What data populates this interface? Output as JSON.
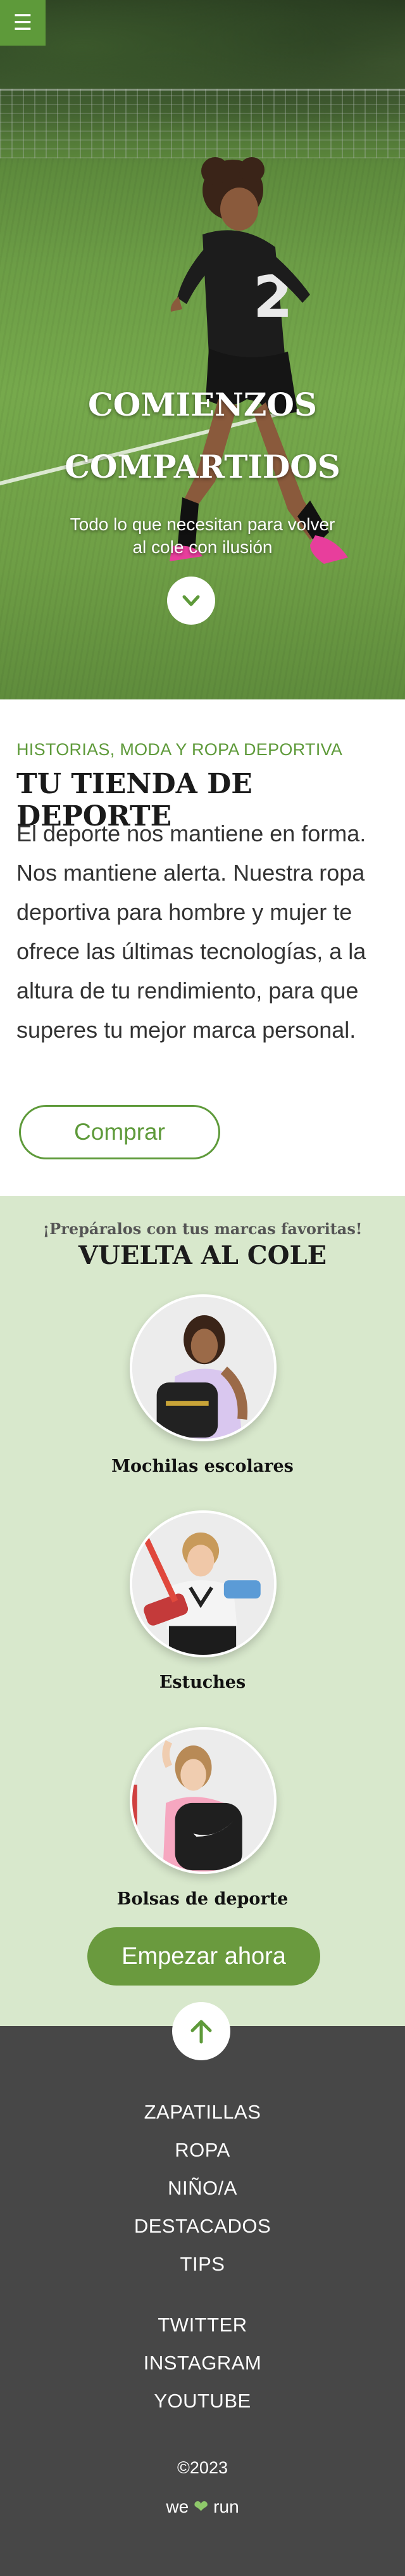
{
  "hero": {
    "title_line1": "COMIENZOS",
    "title_line2": "COMPARTIDOS",
    "subtitle_line1": "Todo lo que necesitan para volver",
    "subtitle_line2": "al cole con ilusión",
    "menu_icon": "hamburger-icon",
    "scroll_icon": "chevron-down-icon"
  },
  "intro": {
    "eyebrow": "HISTORIAS, MODA Y ROPA DEPORTIVA",
    "title": "TU TIENDA DE DEPORTE",
    "body": "El deporte nos mantiene en forma. Nos mantiene alerta. Nuestra ropa deportiva para hombre y mujer te ofrece las últimas tecnologías, a la altura de tu rendimiento, para que superes tu mejor marca personal.",
    "cta": "Comprar"
  },
  "back_to_school": {
    "eyebrow": "¡Prepáralos con tus marcas favoritas!",
    "title": "VUELTA AL COLE",
    "categories": [
      {
        "label": "Mochilas escolares"
      },
      {
        "label": "Estuches"
      },
      {
        "label": "Bolsas de deporte"
      }
    ],
    "cta": "Empezar ahora"
  },
  "footer": {
    "to_top_icon": "arrow-up-icon",
    "nav": [
      "ZAPATILLAS",
      "ROPA",
      "NIÑO/A",
      "DESTACADOS",
      "TIPS"
    ],
    "social": [
      "TWITTER",
      "INSTAGRAM",
      "YOUTUBE"
    ],
    "copyright": "©2023",
    "tagline_pre": "we",
    "tagline_post": "run"
  },
  "colors": {
    "accent": "#5e9a3a",
    "light_green_bg": "#d8e8cc",
    "footer_bg": "#474747"
  }
}
